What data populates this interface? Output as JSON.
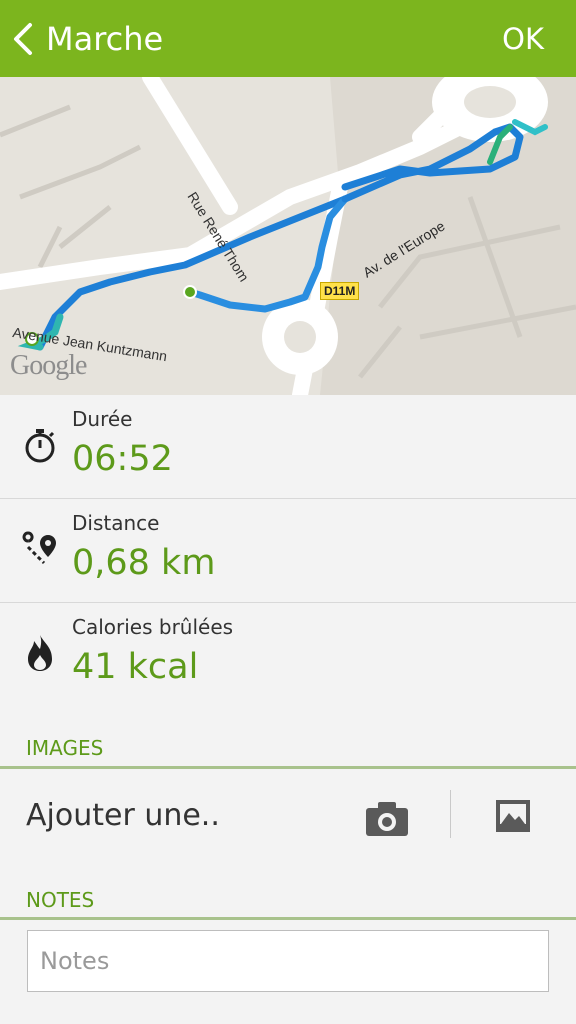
{
  "header": {
    "back_icon": "chevron-left-icon",
    "title": "Marche",
    "ok_label": "OK"
  },
  "map": {
    "street_labels": [
      "Avenue Jean Kuntzmann",
      "Rue René Thom",
      "Av. de l'Europe"
    ],
    "road_badge": "D11M",
    "provider": "Google"
  },
  "stats": [
    {
      "icon": "stopwatch-icon",
      "label": "Durée",
      "value": "06:52"
    },
    {
      "icon": "route-distance-icon",
      "label": "Distance",
      "value": "0,68 km"
    },
    {
      "icon": "flame-icon",
      "label": "Calories brûlées",
      "value": "41 kcal"
    }
  ],
  "images": {
    "section_title": "IMAGES",
    "add_label": "Ajouter une..",
    "camera_icon": "camera-icon",
    "gallery_icon": "gallery-icon"
  },
  "notes": {
    "section_title": "NOTES",
    "placeholder": "Notes"
  },
  "colors": {
    "accent": "#7cb51e",
    "value_text": "#5d9a1a",
    "route": "#1e7fd6"
  }
}
